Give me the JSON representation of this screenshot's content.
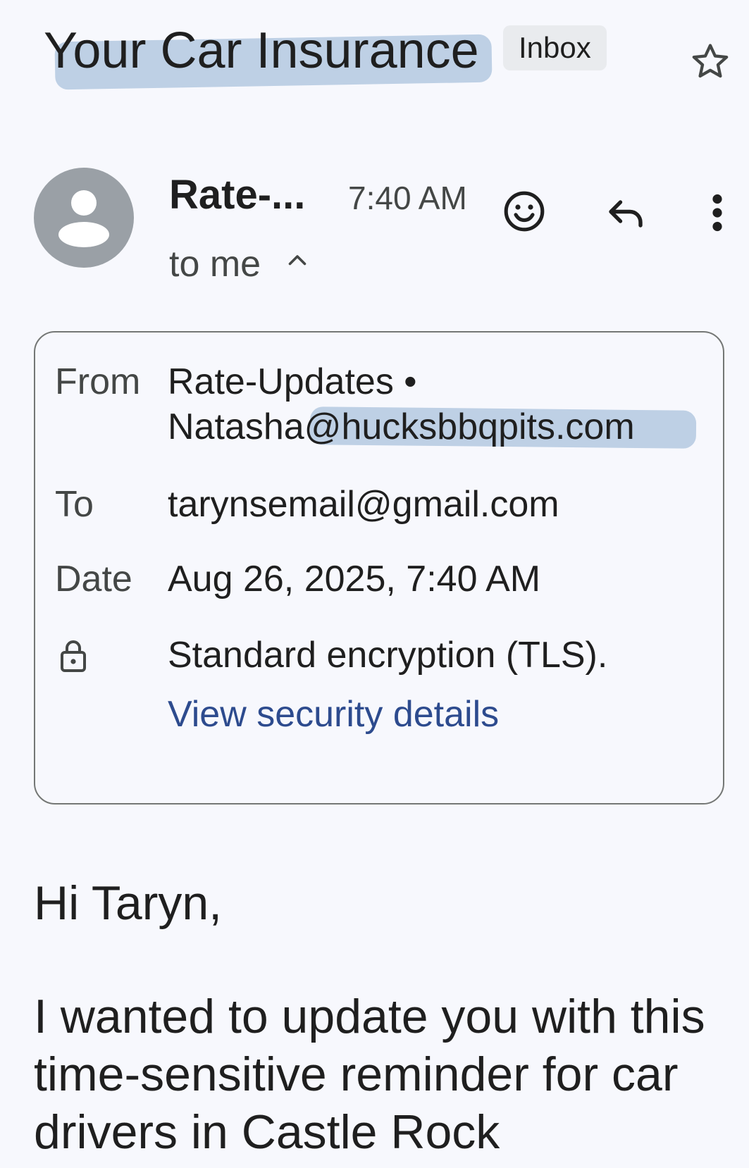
{
  "subject": {
    "title": "Your Car Insurance",
    "label_chip": "Inbox"
  },
  "sender": {
    "name_short": "Rate-...",
    "time": "7:40 AM",
    "recipients_summary": "to me"
  },
  "details": {
    "from_label": "From",
    "from_name": "Rate-Updates •",
    "from_email": "Natasha@hucksbbqpits.com",
    "to_label": "To",
    "to_value": "tarynsemail@gmail.com",
    "date_label": "Date",
    "date_value": "Aug 26, 2025, 7:40 AM",
    "security_text": "Standard encryption (TLS).",
    "security_link": "View security details"
  },
  "body": {
    "greeting": "Hi Taryn,",
    "paragraph": "I wanted to update you with this time-sensitive reminder for car drivers in Castle Rock"
  },
  "icons": {
    "star": "star-outline-icon",
    "emoji": "add-reaction-icon",
    "reply": "reply-icon",
    "more": "more-vert-icon",
    "caret": "chevron-up-icon",
    "lock": "lock-icon",
    "avatar": "default-avatar-icon"
  },
  "colors": {
    "background": "#f7f8fd",
    "text": "#1f1f1f",
    "muted": "#444746",
    "link": "#2d4b8e",
    "highlight": "#78a0c8"
  }
}
